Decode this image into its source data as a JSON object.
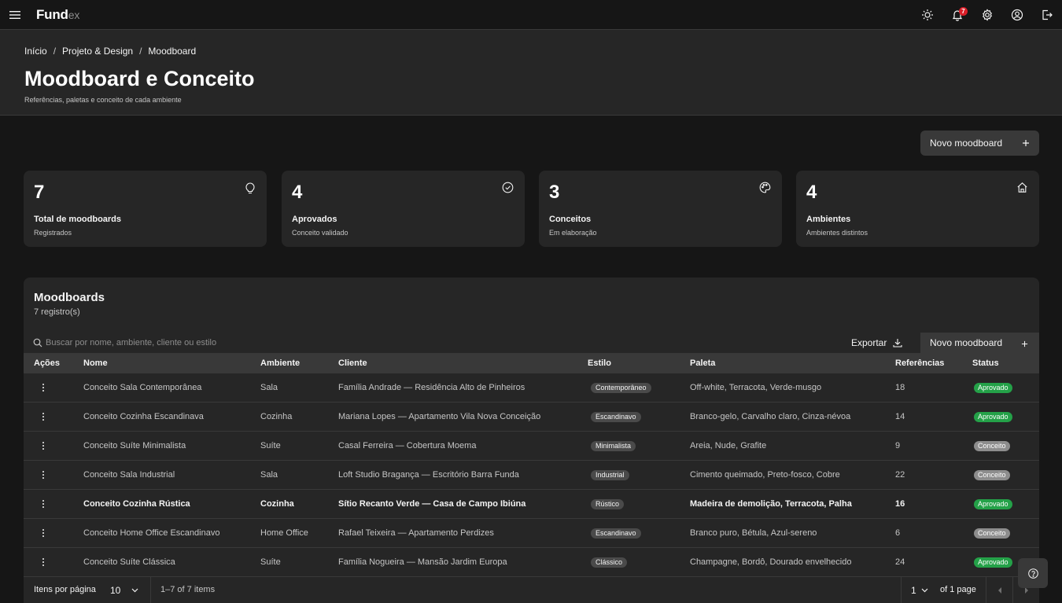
{
  "app": {
    "brand": "Fund",
    "brand_suffix": "ex",
    "notifications_count": "7"
  },
  "icons": {
    "menu": "hamburger-icon",
    "theme": "sun-icon",
    "notifications": "bell-icon",
    "settings": "gear-icon",
    "profile": "user-icon",
    "logout": "logout-icon"
  },
  "breadcrumb": [
    "Início",
    "Projeto & Design",
    "Moodboard"
  ],
  "page": {
    "title": "Moodboard e Conceito",
    "subtitle": "Referências, paletas e conceito de cada ambiente"
  },
  "actions": {
    "new_label": "Novo moodboard",
    "export_label": "Exportar"
  },
  "stats": [
    {
      "value": "7",
      "label": "Total de moodboards",
      "sub": "Registrados",
      "icon": "lightbulb-icon"
    },
    {
      "value": "4",
      "label": "Aprovados",
      "sub": "Conceito validado",
      "icon": "checkmark-circle-icon"
    },
    {
      "value": "3",
      "label": "Conceitos",
      "sub": "Em elaboração",
      "icon": "palette-icon"
    },
    {
      "value": "4",
      "label": "Ambientes",
      "sub": "Ambientes distintos",
      "icon": "home-icon"
    }
  ],
  "table": {
    "title": "Moodboards",
    "count": "7 registro(s)",
    "search_placeholder": "Buscar por nome, ambiente, cliente ou estilo",
    "headers": [
      "Ações",
      "Nome",
      "Ambiente",
      "Cliente",
      "Estilo",
      "Paleta",
      "Referências",
      "Status"
    ],
    "rows": [
      {
        "nome": "Conceito Sala Contemporânea",
        "ambiente": "Sala",
        "cliente": "Família Andrade — Residência Alto de Pinheiros",
        "estilo": "Contemporâneo",
        "paleta": "Off-white, Terracota, Verde-musgo",
        "refs": "18",
        "status": "Aprovado"
      },
      {
        "nome": "Conceito Cozinha Escandinava",
        "ambiente": "Cozinha",
        "cliente": "Mariana Lopes — Apartamento Vila Nova Conceição",
        "estilo": "Escandinavo",
        "paleta": "Branco-gelo, Carvalho claro, Cinza-névoa",
        "refs": "14",
        "status": "Aprovado"
      },
      {
        "nome": "Conceito Suíte Minimalista",
        "ambiente": "Suíte",
        "cliente": "Casal Ferreira — Cobertura Moema",
        "estilo": "Minimalista",
        "paleta": "Areia, Nude, Grafite",
        "refs": "9",
        "status": "Conceito"
      },
      {
        "nome": "Conceito Sala Industrial",
        "ambiente": "Sala",
        "cliente": "Loft Studio Bragança — Escritório Barra Funda",
        "estilo": "Industrial",
        "paleta": "Cimento queimado, Preto-fosco, Cobre",
        "refs": "22",
        "status": "Conceito"
      },
      {
        "nome": "Conceito Cozinha Rústica",
        "ambiente": "Cozinha",
        "cliente": "Sítio Recanto Verde — Casa de Campo Ibiúna",
        "estilo": "Rústico",
        "paleta": "Madeira de demolição, Terracota, Palha",
        "refs": "16",
        "status": "Aprovado"
      },
      {
        "nome": "Conceito Home Office Escandinavo",
        "ambiente": "Home Office",
        "cliente": "Rafael Teixeira — Apartamento Perdizes",
        "estilo": "Escandinavo",
        "paleta": "Branco puro, Bétula, Azul-sereno",
        "refs": "6",
        "status": "Conceito"
      },
      {
        "nome": "Conceito Suíte Clássica",
        "ambiente": "Suíte",
        "cliente": "Família Nogueira — Mansão Jardim Europa",
        "estilo": "Clássico",
        "paleta": "Champagne, Bordô, Dourado envelhecido",
        "refs": "24",
        "status": "Aprovado"
      }
    ]
  },
  "pagination": {
    "items_per_page_label": "Itens por página",
    "items_per_page_value": "10",
    "range_text": "1–7 of 7 items",
    "page_value": "1",
    "page_of_text": "of 1 page"
  },
  "colors": {
    "background": "#161616",
    "surface": "#262626",
    "approved": "#24a148",
    "concept": "#8d8d8d",
    "notification": "#da1e28"
  }
}
